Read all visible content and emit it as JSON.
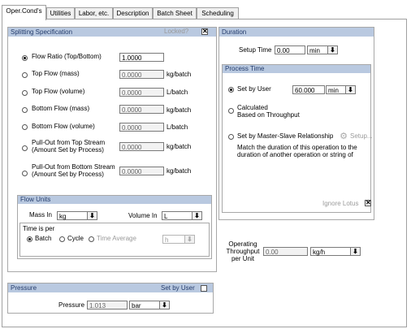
{
  "tabs": [
    "Oper.Cond's",
    "Utilities",
    "Labor, etc.",
    "Description",
    "Batch Sheet",
    "Scheduling"
  ],
  "splitting": {
    "title": "Splitting Specification",
    "locked_label": "Locked?",
    "rows": [
      {
        "label": "Flow Ratio (Top/Bottom)",
        "value": "1.0000",
        "unit": "",
        "selected": true
      },
      {
        "label": "Top Flow (mass)",
        "value": "0.0000",
        "unit": "kg/batch"
      },
      {
        "label": "Top Flow (volume)",
        "value": "0.0000",
        "unit": "L/batch"
      },
      {
        "label": "Bottom Flow (mass)",
        "value": "0.0000",
        "unit": "kg/batch"
      },
      {
        "label": "Bottom Flow (volume)",
        "value": "0.0000",
        "unit": "L/batch"
      },
      {
        "label1": "Pull-Out from Top Stream",
        "label2": "(Amount Set by Process)",
        "value": "0.0000",
        "unit": "kg/batch"
      },
      {
        "label1": "Pull-Out from Bottom Stream",
        "label2": "(Amount Set by Process)",
        "value": "0.0000",
        "unit": "kg/batch"
      }
    ]
  },
  "flow_units": {
    "title": "Flow Units",
    "mass_label": "Mass In",
    "mass_value": "kg",
    "volume_label": "Volume In",
    "volume_value": "L",
    "time_per_label": "Time is per",
    "batch_label": "Batch",
    "cycle_label": "Cycle",
    "time_avg_label": "Time Average",
    "time_avg_unit": "h"
  },
  "duration": {
    "title": "Duration",
    "setup_label": "Setup Time",
    "setup_value": "0.00",
    "setup_unit": "min",
    "process_time_title": "Process Time",
    "set_by_user_label": "Set by User",
    "set_by_user_value": "60.000",
    "set_by_user_unit": "min",
    "calc_label1": "Calculated",
    "calc_label2": "Based on Throughput",
    "master_slave_label": "Set by Master-Slave Relationship",
    "setup_btn_label": "Setup...",
    "master_slave_desc1": "Match the duration of this operation to the",
    "master_slave_desc2": "duration of another operation or string of",
    "ignore_label": "Ignore Lotus"
  },
  "throughput": {
    "label1": "Operating",
    "label2": "Throughput",
    "label3": "per Unit",
    "value": "0.00",
    "unit": "kg/h"
  },
  "pressure": {
    "title": "Pressure",
    "set_by_user_label": "Set by User",
    "label": "Pressure",
    "value": "1.013",
    "unit": "bar"
  },
  "colors": {
    "panel_header_bg": "#b9c9e0",
    "panel_header_text": "#243c6c"
  }
}
